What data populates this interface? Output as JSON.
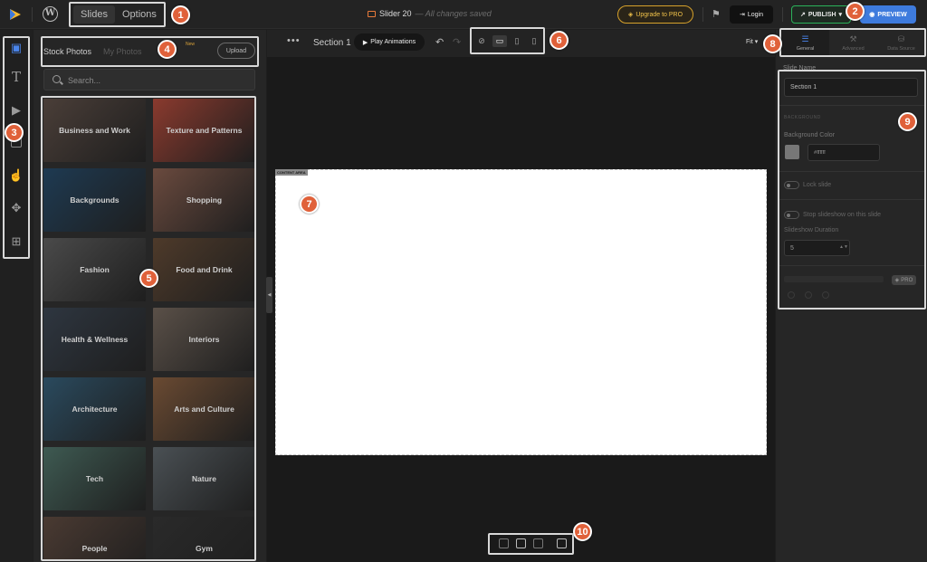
{
  "topbar": {
    "tabs": [
      {
        "label": "Slides",
        "active": true
      },
      {
        "label": "Options",
        "active": false
      }
    ],
    "doc_title": "Slider 20",
    "save_status": "— All changes saved",
    "upgrade_label": "Upgrade to PRO",
    "login_label": "Login",
    "publish_label": "PUBLISH",
    "preview_label": "PREVIEW",
    "colors": {
      "accent": "#3e7bdd",
      "publish": "#2bb35a",
      "upgrade": "#d6a12b"
    }
  },
  "rail": {
    "icons": [
      "image-icon",
      "text-icon",
      "video-icon",
      "shape-icon",
      "button-icon",
      "move-icon",
      "add-icon"
    ],
    "active_index": 0
  },
  "media": {
    "tabs": [
      {
        "label": "Stock Photos",
        "active": true
      },
      {
        "label": "My Photos",
        "active": false
      }
    ],
    "new_badge": "New",
    "upload_label": "Upload",
    "search_placeholder": "Search...",
    "categories": [
      {
        "label": "Business and Work",
        "color": "#4a3e38"
      },
      {
        "label": "Texture and Patterns",
        "color": "#8a3a2e"
      },
      {
        "label": "Backgrounds",
        "color": "#1e3a52"
      },
      {
        "label": "Shopping",
        "color": "#6a4a3e"
      },
      {
        "label": "Fashion",
        "color": "#4a4a4a"
      },
      {
        "label": "Food and Drink",
        "color": "#4e3a2a"
      },
      {
        "label": "Health & Wellness",
        "color": "#2e3640"
      },
      {
        "label": "Interiors",
        "color": "#5a5048"
      },
      {
        "label": "Architecture",
        "color": "#2a4a5e"
      },
      {
        "label": "Arts and Culture",
        "color": "#6a4a32"
      },
      {
        "label": "Tech",
        "color": "#3e5a52"
      },
      {
        "label": "Nature",
        "color": "#4a5054"
      },
      {
        "label": "People",
        "color": "#4a3a32"
      },
      {
        "label": "Gym",
        "color": "#2a2a2a"
      }
    ]
  },
  "editor": {
    "section_label": "Section 1",
    "play_label": "Play Animations",
    "devices": [
      {
        "icon": "eye-off-icon",
        "active": false
      },
      {
        "icon": "desktop-icon",
        "active": true
      },
      {
        "icon": "tablet-icon",
        "active": false
      },
      {
        "icon": "mobile-icon",
        "active": false
      }
    ],
    "fit_label": "Fit",
    "content_area_label": "CONTENT AREA"
  },
  "settings": {
    "tabs": [
      {
        "label": "General",
        "icon": "sliders-icon",
        "active": true
      },
      {
        "label": "Advanced",
        "icon": "wrench-icon",
        "active": false
      },
      {
        "label": "Data Source",
        "icon": "database-icon",
        "active": false
      }
    ],
    "slide_name_label": "Slide Name",
    "slide_name_value": "Section 1",
    "background_heading": "BACKGROUND",
    "bg_color_label": "Background Color",
    "bg_color_value": "#ffffff",
    "lock_label": "Lock slide",
    "stop_label": "Stop slideshow on this slide",
    "duration_label": "Slideshow Duration",
    "duration_value": "5",
    "pro_label": "PRO"
  },
  "markers": [
    "1",
    "2",
    "3",
    "4",
    "5",
    "6",
    "7",
    "8",
    "9",
    "10"
  ]
}
